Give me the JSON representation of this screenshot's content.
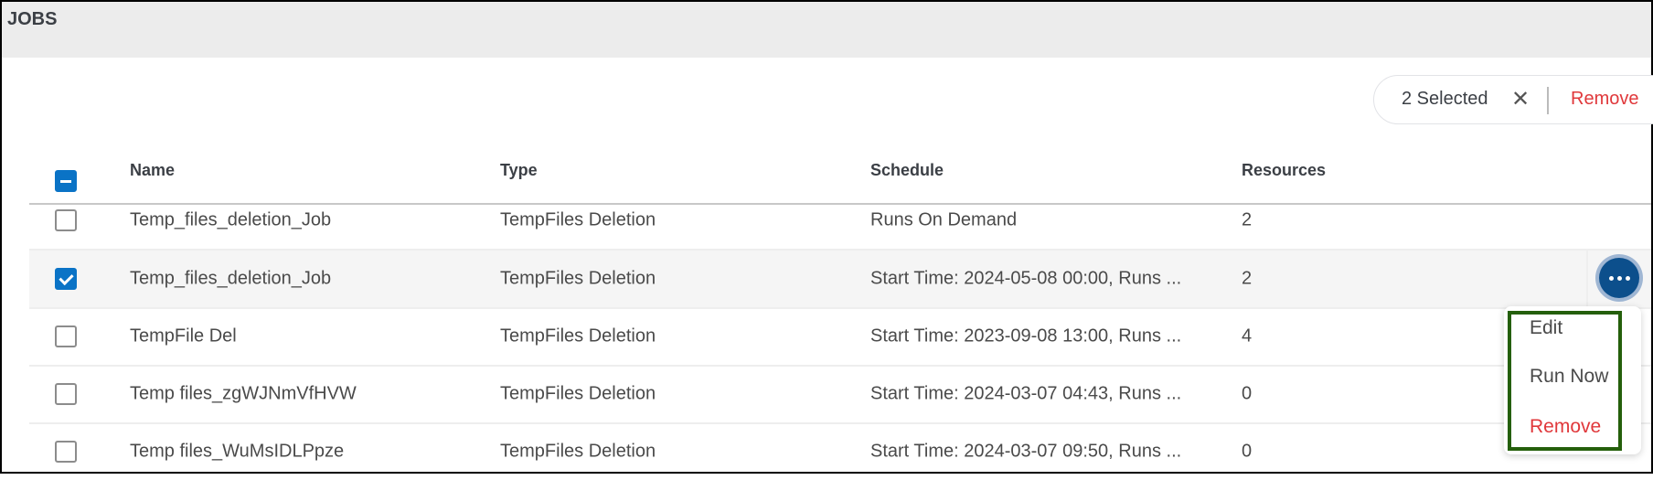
{
  "header": {
    "title": "JOBS"
  },
  "selection_bar": {
    "count_label": "2 Selected",
    "clear_icon": "close-icon",
    "remove_label": "Remove"
  },
  "table": {
    "select_all_state": "indeterminate",
    "columns": [
      "Name",
      "Type",
      "Schedule",
      "Resources"
    ],
    "rows": [
      {
        "checked": false,
        "name": "Temp_files_deletion_Job",
        "type": "TempFiles Deletion",
        "schedule": "Runs On Demand",
        "resources": "2"
      },
      {
        "checked": true,
        "name": "Temp_files_deletion_Job",
        "type": "TempFiles Deletion",
        "schedule": "Start Time: 2024-05-08 00:00, Runs ...",
        "resources": "2"
      },
      {
        "checked": false,
        "name": "TempFile Del",
        "type": "TempFiles Deletion",
        "schedule": "Start Time: 2023-09-08 13:00, Runs ...",
        "resources": "4"
      },
      {
        "checked": false,
        "name": "Temp files_zgWJNmVfHVW",
        "type": "TempFiles Deletion",
        "schedule": "Start Time: 2024-03-07 04:43, Runs ...",
        "resources": "0"
      },
      {
        "checked": false,
        "name": "Temp files_WuMsIDLPpze",
        "type": "TempFiles Deletion",
        "schedule": "Start Time: 2024-03-07 09:50, Runs ...",
        "resources": "0"
      }
    ]
  },
  "row_actions": {
    "icon": "more-horizontal-icon",
    "menu": [
      {
        "label": "Edit"
      },
      {
        "label": "Run Now"
      },
      {
        "label": "Remove",
        "danger": true
      }
    ]
  },
  "colors": {
    "accent": "#0a73c6",
    "action_button": "#0c4f8c",
    "danger": "#e0383b",
    "highlight_outline": "#245f0b"
  }
}
